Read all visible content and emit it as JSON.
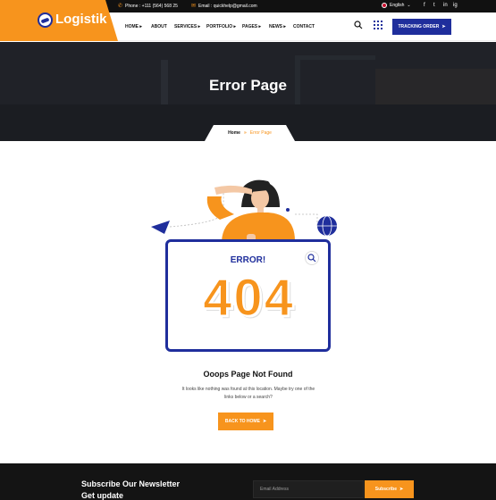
{
  "brand": {
    "name": "Logistik"
  },
  "topbar": {
    "phone_label": "Phone : +111 (564) 568 25",
    "email_label": "Email : quickhelp@gmail.com",
    "language": "English",
    "socials": [
      "f",
      "t",
      "in",
      "ig"
    ]
  },
  "nav": {
    "items": [
      "HOME",
      "ABOUT",
      "SERVICES",
      "PORTFOLIO",
      "PAGES",
      "NEWS",
      "CONTACT"
    ],
    "track_label": "TRACKING ORDER"
  },
  "banner": {
    "title": "Error Page"
  },
  "breadcrumb": {
    "home": "Home",
    "separator": "»",
    "current": "Error Page"
  },
  "error": {
    "label": "ERROR!",
    "code": [
      "4",
      "0",
      "4"
    ],
    "heading": "Ooops Page Not Found",
    "description": "It looks like nothing was found at this location. Maybe try one of the links below or a search?",
    "back_label": "BACK TO HOME"
  },
  "footer": {
    "subscribe_title_1": "Subscribe Our Newsletter",
    "subscribe_title_2": "Get update",
    "email_placeholder": "Email Address",
    "subscribe_label": "Subscribe"
  },
  "colors": {
    "accent": "#f7941d",
    "brand": "#1f2e9c",
    "dark": "#141414"
  }
}
